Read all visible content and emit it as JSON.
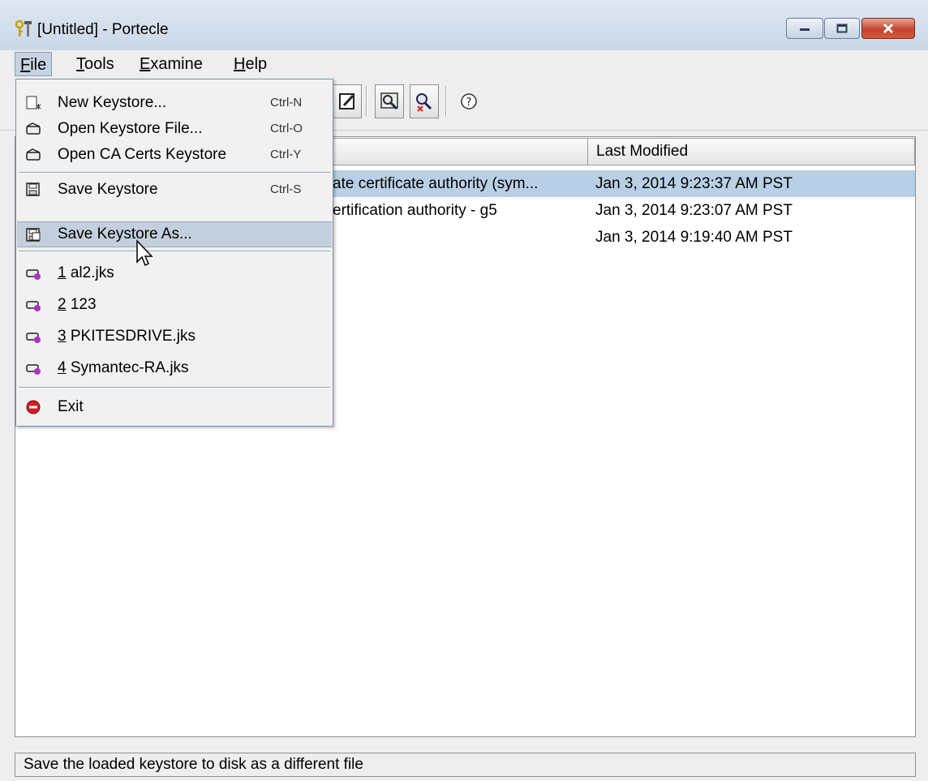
{
  "window": {
    "title": "[Untitled] - Portecle",
    "controls": [
      "minimize",
      "maximize",
      "close"
    ]
  },
  "menubar": {
    "items": [
      {
        "label": "File",
        "mnemonic": "F"
      },
      {
        "label": "Tools",
        "mnemonic": "T"
      },
      {
        "label": "Examine",
        "mnemonic": "E"
      },
      {
        "label": "Help",
        "mnemonic": "H"
      }
    ]
  },
  "file_menu": {
    "new": {
      "label": "New Keystore...",
      "accel": "Ctrl-N"
    },
    "open": {
      "label": "Open Keystore File...",
      "accel": "Ctrl-O"
    },
    "open_ca": {
      "label": "Open CA Certs Keystore",
      "accel": "Ctrl-Y"
    },
    "save": {
      "label": "Save Keystore",
      "accel": "Ctrl-S"
    },
    "save_as": {
      "label": "Save Keystore As..."
    },
    "recent": [
      {
        "num": "1",
        "name": " al2.jks"
      },
      {
        "num": "2",
        "name": " 123"
      },
      {
        "num": "3",
        "name": " PKITESDRIVE.jks"
      },
      {
        "num": "4",
        "name": " Symantec-RA.jks"
      }
    ],
    "exit": {
      "label": "Exit"
    }
  },
  "table": {
    "column_last_modified": "Last Modified",
    "rows": [
      {
        "alias": "ate certificate authority (sym...",
        "modified": "Jan 3, 2014 9:23:37 AM PST",
        "selected": true
      },
      {
        "alias": "ertification authority - g5",
        "modified": "Jan 3, 2014 9:23:07 AM PST",
        "selected": false
      },
      {
        "alias": "",
        "modified": "Jan 3, 2014 9:19:40 AM PST",
        "selected": false
      }
    ]
  },
  "status": {
    "text": "Save the loaded keystore to disk as a different file"
  },
  "colors": {
    "selection": "#b8cfe5",
    "menu_highlight": "#c3cfdc",
    "close_button": "#c6452f"
  }
}
